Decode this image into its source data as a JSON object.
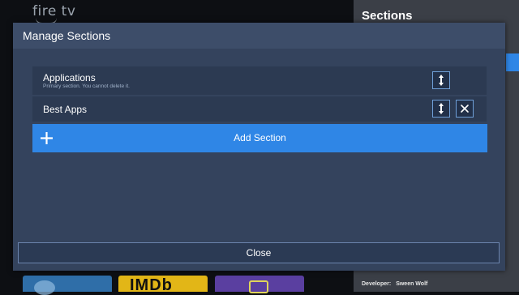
{
  "background": {
    "logo_text": "fire tv",
    "side_panel": {
      "title": "Sections",
      "developer_label": "Developer:",
      "developer_name": "Sween Wolf"
    },
    "tiles": [
      {
        "name": "tile-1",
        "text": ""
      },
      {
        "name": "tile-imdb",
        "text": "IMDb"
      },
      {
        "name": "tile-3",
        "text": ""
      }
    ]
  },
  "dialog": {
    "title": "Manage Sections",
    "sections": [
      {
        "label": "Applications",
        "subtitle": "Primary section. You cannot delete it.",
        "can_move": true,
        "can_delete": false
      },
      {
        "label": "Best Apps",
        "subtitle": "",
        "can_move": true,
        "can_delete": true
      }
    ],
    "add_label": "Add Section",
    "close_label": "Close"
  },
  "colors": {
    "accent": "#2f86e6",
    "dialog_bg": "#34435d",
    "row_bg": "#2c3a52"
  },
  "icons": {
    "move": "up-down-arrows-icon",
    "delete": "close-x-icon",
    "add": "plus-icon"
  }
}
